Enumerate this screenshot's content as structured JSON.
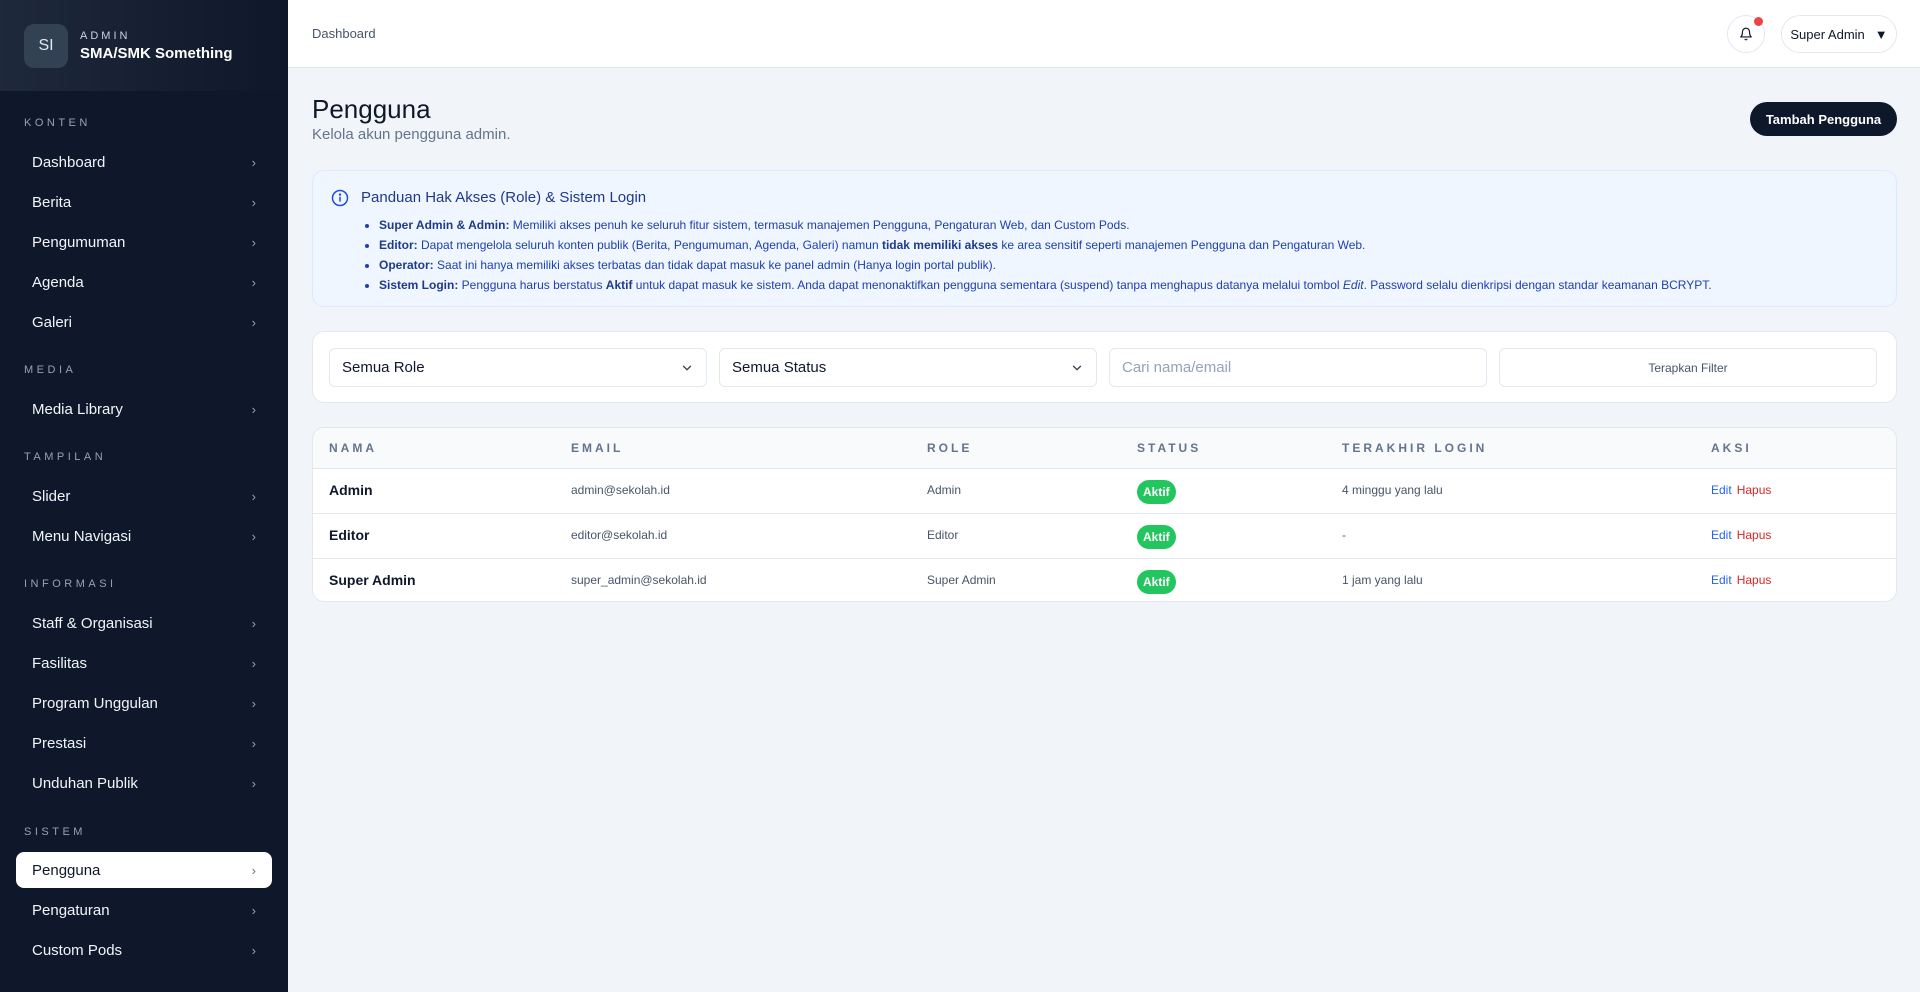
{
  "sidebar": {
    "logo_initials": "SI",
    "kicker": "ADMIN",
    "school_name": "SMA/SMK Something",
    "sections": [
      {
        "label": "KONTEN",
        "items": [
          "Dashboard",
          "Berita",
          "Pengumuman",
          "Agenda",
          "Galeri"
        ]
      },
      {
        "label": "MEDIA",
        "items": [
          "Media Library"
        ]
      },
      {
        "label": "TAMPILAN",
        "items": [
          "Slider",
          "Menu Navigasi"
        ]
      },
      {
        "label": "INFORMASI",
        "items": [
          "Staff & Organisasi",
          "Fasilitas",
          "Program Unggulan",
          "Prestasi",
          "Unduhan Publik"
        ]
      },
      {
        "label": "SISTEM",
        "items": [
          "Pengguna",
          "Pengaturan",
          "Custom Pods"
        ]
      }
    ],
    "active_item": "Pengguna"
  },
  "topbar": {
    "breadcrumb": "Dashboard",
    "bell_icon": "bell-icon",
    "user_label": "Super Admin",
    "user_caret": "▼"
  },
  "page": {
    "title": "Pengguna",
    "subtitle": "Kelola akun pengguna admin.",
    "add_button": "Tambah Pengguna"
  },
  "info": {
    "icon": "info-icon",
    "title": "Panduan Hak Akses (Role) & Sistem Login",
    "items": [
      {
        "strong": "Super Admin & Admin:",
        "text": " Memiliki akses penuh ke seluruh fitur sistem, termasuk manajemen Pengguna, Pengaturan Web, dan Custom Pods."
      },
      {
        "strong": "Editor:",
        "text": " Dapat mengelola seluruh konten publik (Berita, Pengumuman, Agenda, Galeri) namun ",
        "strong2": "tidak memiliki akses",
        "text2": " ke area sensitif seperti manajemen Pengguna dan Pengaturan Web."
      },
      {
        "strong": "Operator:",
        "text": " Saat ini hanya memiliki akses terbatas dan tidak dapat masuk ke panel admin (Hanya login portal publik)."
      },
      {
        "strong": "Sistem Login:",
        "text": " Pengguna harus berstatus ",
        "strong2": "Aktif",
        "text2": " untuk dapat masuk ke sistem. Anda dapat menonaktifkan pengguna sementara (suspend) tanpa menghapus datanya melalui tombol ",
        "em": "Edit",
        "text3": ". Password selalu dienkripsi dengan standar keamanan BCRYPT."
      }
    ]
  },
  "filters": {
    "role_select": "Semua Role",
    "status_select": "Semua Status",
    "search_placeholder": "Cari nama/email",
    "apply_button": "Terapkan Filter"
  },
  "table": {
    "headers": [
      "NAMA",
      "EMAIL",
      "ROLE",
      "STATUS",
      "TERAKHIR LOGIN",
      "AKSI"
    ],
    "rows": [
      {
        "name": "Admin",
        "email": "admin@sekolah.id",
        "role": "Admin",
        "status": "Aktif",
        "last_login": "4 minggu yang lalu",
        "edit": "Edit",
        "delete": "Hapus"
      },
      {
        "name": "Editor",
        "email": "editor@sekolah.id",
        "role": "Editor",
        "status": "Aktif",
        "last_login": "-",
        "edit": "Edit",
        "delete": "Hapus"
      },
      {
        "name": "Super Admin",
        "email": "super_admin@sekolah.id",
        "role": "Super Admin",
        "status": "Aktif",
        "last_login": "1 jam yang lalu",
        "edit": "Edit",
        "delete": "Hapus"
      }
    ]
  },
  "colors": {
    "sidebar_bg": "#0f172a",
    "accent_dark": "#0f172a",
    "status_active": "#22c55e",
    "link_edit": "#2563eb",
    "link_delete": "#dc2626"
  }
}
